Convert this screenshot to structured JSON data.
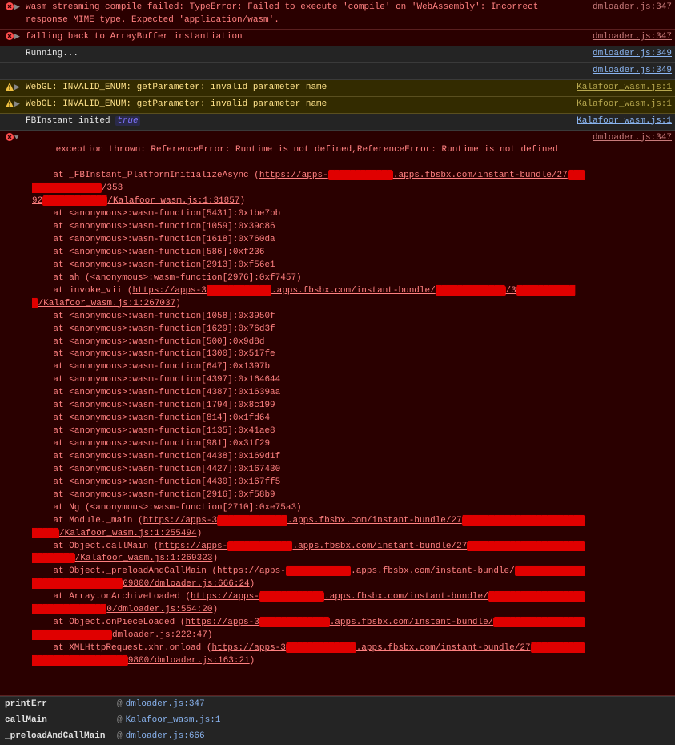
{
  "icons": {
    "error_fill": "#ff4d4d",
    "warning_fill": "#f0c040"
  },
  "rows": [
    {
      "type": "error",
      "arrow": "▶",
      "message": "wasm streaming compile failed: TypeError: Failed to execute 'compile' on 'WebAssembly': Incorrect response MIME type. Expected 'application/wasm'.",
      "source": "dmloader.js:347"
    },
    {
      "type": "error",
      "arrow": "▶",
      "message": "falling back to ArrayBuffer instantiation",
      "source": "dmloader.js:347"
    },
    {
      "type": "log",
      "arrow": "",
      "message": "Running...",
      "source": "dmloader.js:349"
    },
    {
      "type": "log",
      "arrow": "",
      "message": "",
      "source": "dmloader.js:349"
    },
    {
      "type": "warning",
      "arrow": "▶",
      "message": "WebGL: INVALID_ENUM: getParameter: invalid parameter name",
      "source": "Kalafoor_wasm.js:1"
    },
    {
      "type": "warning",
      "arrow": "▶",
      "message": "WebGL: INVALID_ENUM: getParameter: invalid parameter name",
      "source": "Kalafoor_wasm.js:1"
    },
    {
      "type": "log",
      "arrow": "",
      "message": "FBInstant inited ",
      "extra_pill": "true",
      "source": "Kalafoor_wasm.js:1"
    }
  ],
  "exception": {
    "source": "dmloader.js:347",
    "arrow": "▼",
    "headline": "exception thrown: ReferenceError: Runtime is not defined,ReferenceError: Runtime is not defined",
    "first_frame_pre": "    at _FBInstant_PlatformInitializeAsync (",
    "first_frame_link": "https://apps-████████████.apps.fbsbx.com/instant-bundle/27████████████████/353",
    "first_frame_tail": "92████████████/Kalafoor_wasm.js:1:31857",
    "wasm_frames": [
      "    at <anonymous>:wasm-function[5431]:0x1be7bb",
      "    at <anonymous>:wasm-function[1059]:0x39c86",
      "    at <anonymous>:wasm-function[1618]:0x760da",
      "    at <anonymous>:wasm-function[586]:0xf236",
      "    at <anonymous>:wasm-function[2913]:0xf56e1",
      "    at ah (<anonymous>:wasm-function[2976]:0xf7457)"
    ],
    "invoke_pre": "    at invoke_vii (",
    "invoke_link": "https://apps-3████████████.apps.fbsbx.com/instant-bundle/█████████████/3████████████/Kalafoor_wasm.js:1:267037",
    "wasm_frames2": [
      "    at <anonymous>:wasm-function[1058]:0x3950f",
      "    at <anonymous>:wasm-function[1629]:0x76d3f",
      "    at <anonymous>:wasm-function[500]:0x9d8d",
      "    at <anonymous>:wasm-function[1300]:0x517fe",
      "    at <anonymous>:wasm-function[647]:0x1397b",
      "    at <anonymous>:wasm-function[4397]:0x164644",
      "    at <anonymous>:wasm-function[4387]:0x1639aa",
      "    at <anonymous>:wasm-function[1794]:0x8c199",
      "    at <anonymous>:wasm-function[814]:0x1fd64",
      "    at <anonymous>:wasm-function[1135]:0x41ae8",
      "    at <anonymous>:wasm-function[981]:0x31f29",
      "    at <anonymous>:wasm-function[4438]:0x169d1f",
      "    at <anonymous>:wasm-function[4427]:0x167430",
      "    at <anonymous>:wasm-function[4430]:0x167ff5",
      "    at <anonymous>:wasm-function[2916]:0xf58b9",
      "    at Ng (<anonymous>:wasm-function[2710]:0xe75a3)"
    ],
    "tail_frames": [
      {
        "pre": "    at Module._main (",
        "link": "https://apps-3█████████████.apps.fbsbx.com/instant-bundle/27████████████████████████████/Kalafoor_wasm.js:1:255494"
      },
      {
        "pre": "    at Object.callMain (",
        "link": "https://apps-████████████.apps.fbsbx.com/instant-bundle/27██████████████████████████████/Kalafoor_wasm.js:1:269323"
      },
      {
        "pre": "    at Object._preloadAndCallMain (",
        "link": "https://apps-████████████.apps.fbsbx.com/instant-bundle/██████████████████████████████09800/dmloader.js:666:24"
      },
      {
        "pre": "    at Array.onArchiveLoaded (",
        "link": "https://apps-████████████.apps.fbsbx.com/instant-bundle/████████████████████████████████0/dmloader.js:554:20"
      },
      {
        "pre": "    at Object.onPieceLoaded (",
        "link": "https://apps-3█████████████.apps.fbsbx.com/instant-bundle/████████████████████████████████dmloader.js:222:47"
      },
      {
        "pre": "    at XMLHttpRequest.xhr.onload (",
        "link": "https://apps-3█████████████.apps.fbsbx.com/instant-bundle/27████████████████████████████9800/dmloader.js:163:21"
      }
    ]
  },
  "call_table": [
    {
      "fn": "printErr",
      "at": "@",
      "src": "dmloader.js:347"
    },
    {
      "fn": "callMain",
      "at": "@",
      "src": "Kalafoor_wasm.js:1"
    },
    {
      "fn": "_preloadAndCallMain",
      "at": "@",
      "src": "dmloader.js:666"
    }
  ]
}
